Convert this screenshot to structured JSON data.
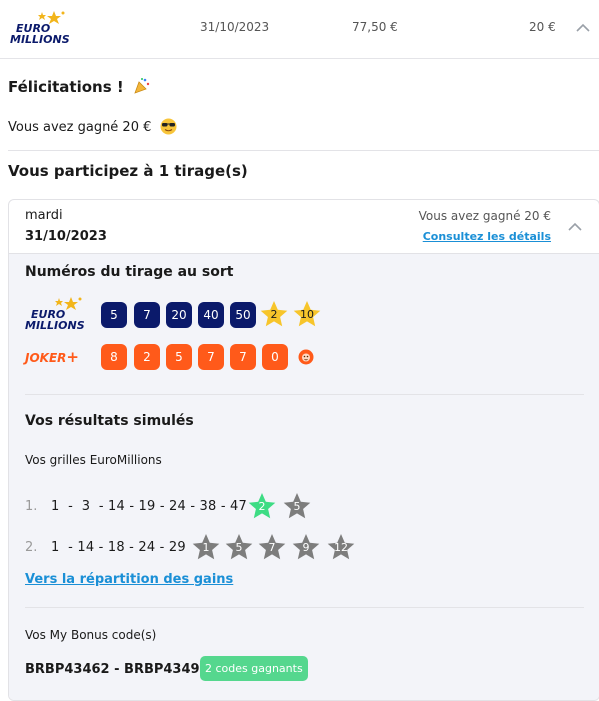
{
  "header": {
    "logo_top": "EURO",
    "logo_bottom": "MILLIONS",
    "date": "31/10/2023",
    "stake": "77,50 €",
    "won": "20 €"
  },
  "congrats": {
    "title": "Félicitations !",
    "won_text": "Vous avez gagné 20 €"
  },
  "participation": {
    "title": "Vous participez à 1 tirage(s)"
  },
  "draw": {
    "day": "mardi",
    "date": "31/10/2023",
    "won_text": "Vous avez gagné 20 €",
    "details_link": "Consultez les détails",
    "numbers_title": "Numéros du tirage au sort",
    "euro_logo_top": "EURO",
    "euro_logo_bottom": "MILLIONS",
    "balls": [
      "5",
      "7",
      "20",
      "40",
      "50"
    ],
    "stars": [
      "2",
      "10"
    ],
    "joker_label": "JOKER",
    "joker_plus": "+",
    "joker_digits": [
      "8",
      "2",
      "5",
      "7",
      "7",
      "0"
    ]
  },
  "results": {
    "title": "Vos résultats simulés",
    "grids_title": "Vos grilles EuroMillions",
    "grids": [
      {
        "index": "1.",
        "numbers": "1  -  3  - 14 - 19 - 24 - 38 - 47",
        "stars": [
          "2",
          "5"
        ]
      },
      {
        "index": "2.",
        "numbers": "1  - 14 - 18 - 24 - 29",
        "stars": [
          "1",
          "5",
          "7",
          "9",
          "12"
        ]
      }
    ],
    "gains_link": "Vers la répartition des gains",
    "bonus_title": "Vos My Bonus code(s)",
    "bonus_codes": "BRBP43462 - BRBP43492",
    "bonus_badge": "2 codes gagnants"
  },
  "colors": {
    "ball_blue": "#0b1a6b",
    "star_gold": "#f7c52b",
    "joker_orange": "#ff5a1a",
    "star_win_green": "#3ddc84",
    "star_grey": "#7d7d7d",
    "link_blue": "#1a8fd6",
    "badge_green": "#55d78e"
  }
}
